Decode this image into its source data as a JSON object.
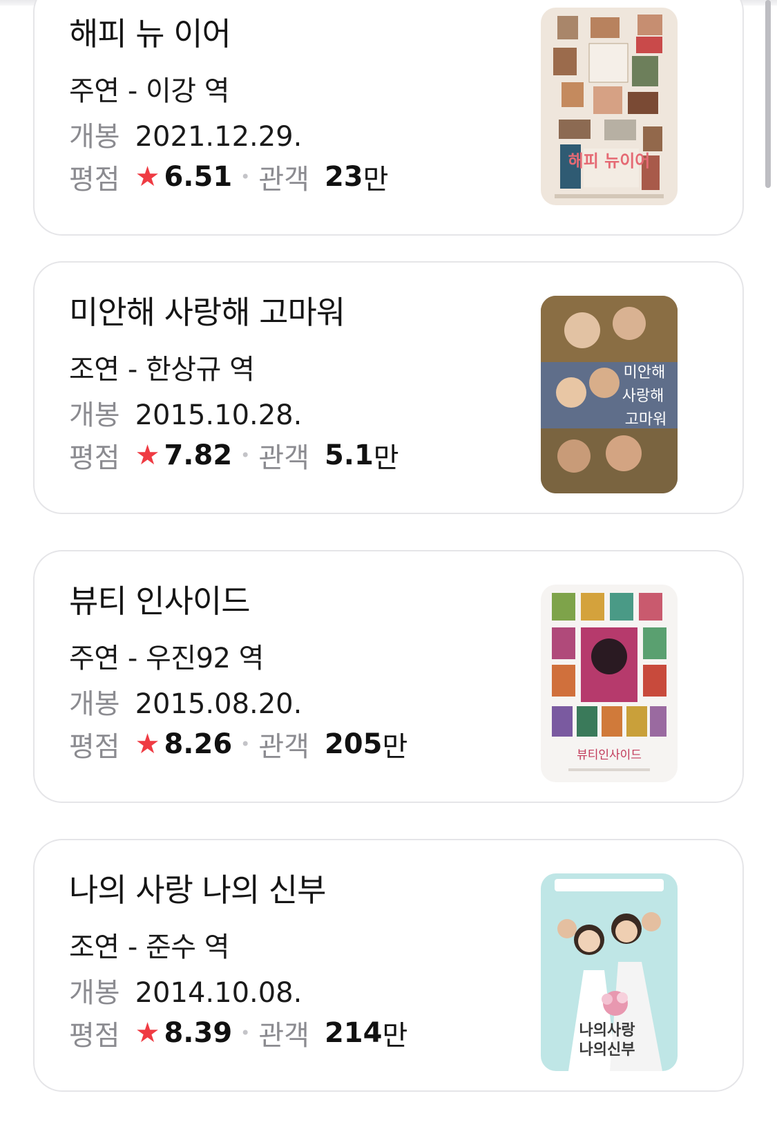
{
  "labels": {
    "release": "개봉",
    "rating": "평점",
    "audience": "관객",
    "star": "★",
    "separator": "•"
  },
  "movies": [
    {
      "title": "해피 뉴 이어",
      "role": "주연 - 이강 역",
      "release_date": "2021.12.29.",
      "score": "6.51",
      "audience": "23",
      "audience_unit": "만",
      "poster_alt": "해피 뉴이어"
    },
    {
      "title": "미안해 사랑해 고마워",
      "role": "조연 - 한상규 역",
      "release_date": "2015.10.28.",
      "score": "7.82",
      "audience": "5.1",
      "audience_unit": "만",
      "poster_alt": "미안해 사랑해 고마워"
    },
    {
      "title": "뷰티 인사이드",
      "role": "주연 - 우진92 역",
      "release_date": "2015.08.20.",
      "score": "8.26",
      "audience": "205",
      "audience_unit": "만",
      "poster_alt": "뷰티인사이드"
    },
    {
      "title": "나의 사랑 나의 신부",
      "role": "조연 - 준수 역",
      "release_date": "2014.10.08.",
      "score": "8.39",
      "audience": "214",
      "audience_unit": "만",
      "poster_alt": "나의사랑 나의신부"
    }
  ],
  "colors": {
    "star": "#ef3b43",
    "label_gray": "#8b8b90",
    "card_border": "#e5e5e8"
  }
}
